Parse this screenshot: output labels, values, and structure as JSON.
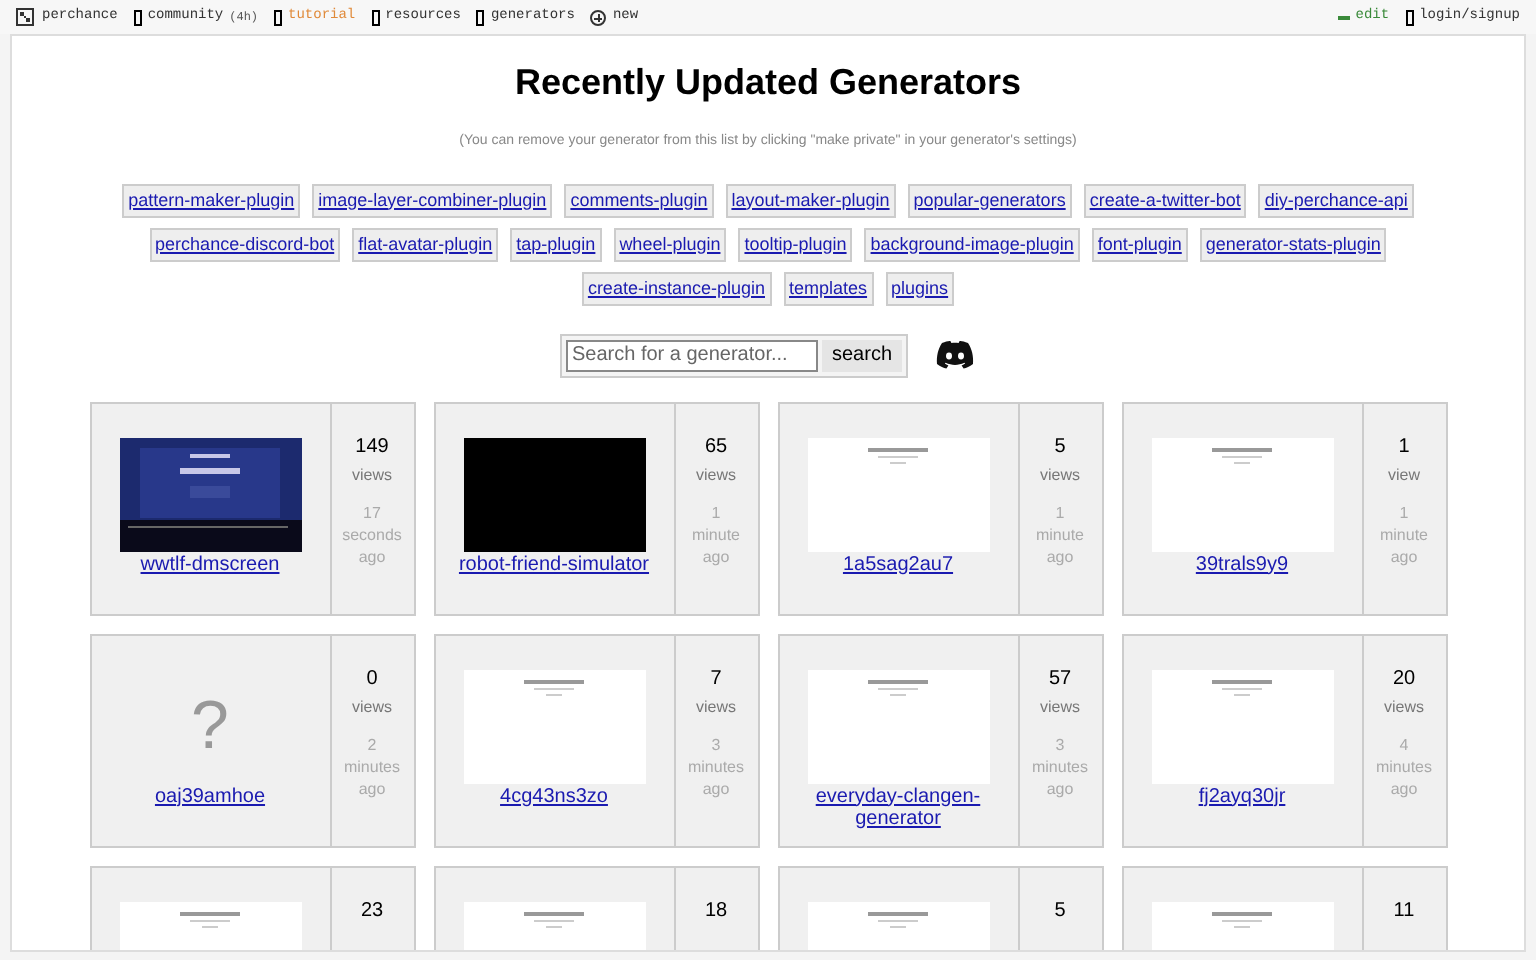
{
  "nav": {
    "logo": "perchance",
    "items": [
      {
        "label": "community",
        "badge": "(4h)",
        "kind": "normal"
      },
      {
        "label": "tutorial",
        "kind": "highlight"
      },
      {
        "label": "resources",
        "kind": "normal"
      },
      {
        "label": "generators",
        "kind": "normal"
      },
      {
        "label": "new",
        "kind": "new"
      }
    ],
    "right": [
      {
        "label": "edit",
        "kind": "edit"
      },
      {
        "label": "login/signup",
        "kind": "normal"
      }
    ]
  },
  "title": "Recently Updated Generators",
  "subtitle": "(You can remove your generator from this list by clicking \"make private\" in your generator's settings)",
  "tags": [
    [
      "pattern-maker-plugin",
      "image-layer-combiner-plugin",
      "comments-plugin",
      "layout-maker-plugin",
      "popular-generators",
      "create-a-twitter-bot",
      "diy-perchance-api"
    ],
    [
      "perchance-discord-bot",
      "flat-avatar-plugin",
      "tap-plugin",
      "wheel-plugin",
      "tooltip-plugin",
      "background-image-plugin",
      "font-plugin",
      "generator-stats-plugin"
    ],
    [
      "create-instance-plugin",
      "templates",
      "plugins"
    ]
  ],
  "search": {
    "placeholder": "Search for a generator...",
    "button": "search"
  },
  "generators": [
    {
      "name": "wwtlf-dmscreen",
      "views": "149",
      "views_label": "views",
      "time": [
        "17",
        "seconds",
        "ago"
      ],
      "kind": "dark"
    },
    {
      "name": "robot-friend-simulator",
      "views": "65",
      "views_label": "views",
      "time": [
        "1",
        "minute",
        "ago"
      ],
      "kind": "black"
    },
    {
      "name": "1a5sag2au7",
      "views": "5",
      "views_label": "views",
      "time": [
        "1",
        "minute",
        "ago"
      ],
      "kind": "light"
    },
    {
      "name": "39trals9y9",
      "views": "1",
      "views_label": "view",
      "time": [
        "1",
        "minute",
        "ago"
      ],
      "kind": "light"
    },
    {
      "name": "oaj39amhoe",
      "views": "0",
      "views_label": "views",
      "time": [
        "2",
        "minutes",
        "ago"
      ],
      "kind": "none",
      "placeholder_mark": "?"
    },
    {
      "name": "4cg43ns3zo",
      "views": "7",
      "views_label": "views",
      "time": [
        "3",
        "minutes",
        "ago"
      ],
      "kind": "light"
    },
    {
      "name": "everyday-clangen-generator",
      "views": "57",
      "views_label": "views",
      "time": [
        "3",
        "minutes",
        "ago"
      ],
      "kind": "light"
    },
    {
      "name": "fj2ayq30jr",
      "views": "20",
      "views_label": "views",
      "time": [
        "4",
        "minutes",
        "ago"
      ],
      "kind": "light"
    },
    {
      "views": "23",
      "kind": "light"
    },
    {
      "views": "18",
      "kind": "light"
    },
    {
      "views": "5",
      "kind": "light"
    },
    {
      "views": "11",
      "kind": "light"
    }
  ]
}
